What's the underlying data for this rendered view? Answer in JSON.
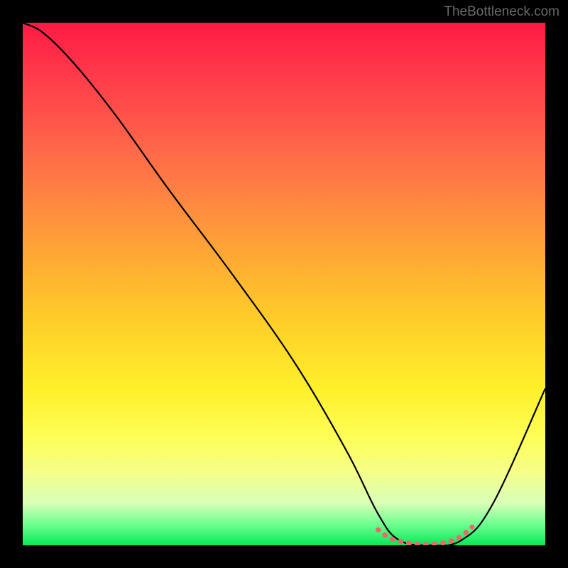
{
  "watermark": "TheBottleneck.com",
  "chart_data": {
    "type": "line",
    "title": "",
    "xlabel": "",
    "ylabel": "",
    "xlim": [
      0,
      100
    ],
    "ylim": [
      0,
      100
    ],
    "grid": false,
    "series": [
      {
        "name": "bottleneck-curve",
        "x": [
          0,
          4,
          10,
          18,
          28,
          40,
          52,
          62,
          68,
          72,
          78,
          84,
          90,
          100
        ],
        "y": [
          100,
          98,
          92,
          82,
          68,
          52,
          35,
          18,
          6,
          1,
          0,
          1,
          8,
          30
        ],
        "color": "#000000"
      },
      {
        "name": "optimal-range-marker",
        "x": [
          68,
          70,
          72,
          74,
          76,
          78,
          80,
          82,
          84,
          86
        ],
        "y": [
          3.0,
          1.5,
          0.8,
          0.4,
          0.2,
          0.2,
          0.4,
          0.8,
          1.8,
          3.5
        ],
        "color": "#e86a6a"
      }
    ],
    "background_gradient": {
      "top": "#ff1a44",
      "mid_upper": "#ff9a3a",
      "mid": "#fff02a",
      "mid_lower": "#f6ff8a",
      "bottom": "#08e858"
    }
  }
}
